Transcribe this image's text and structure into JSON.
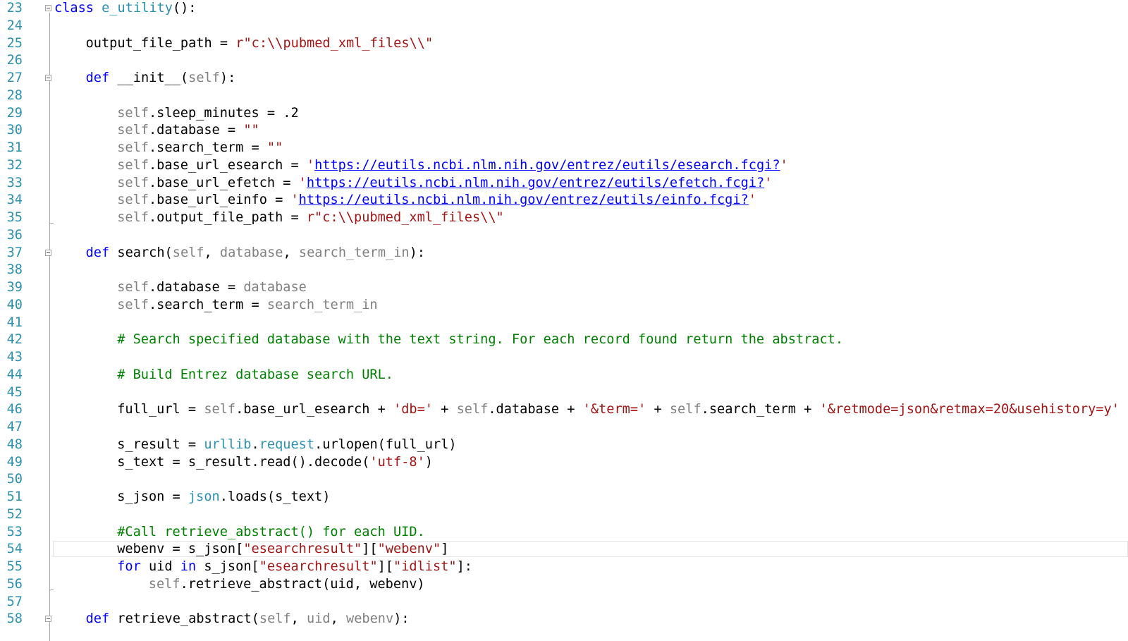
{
  "editor": {
    "first_line": 23,
    "colors": {
      "keyword": "#0000ff",
      "string": "#a31515",
      "comment": "#008000",
      "self_param": "#808080",
      "module": "#2b91af",
      "line_number": "#2b91af"
    },
    "fold_markers": [
      23,
      27,
      37,
      58
    ],
    "lines": [
      {
        "n": "23",
        "indent": 0,
        "tokens": [
          {
            "t": "class ",
            "c": "kw"
          },
          {
            "t": "e_utility",
            "c": "mod"
          },
          {
            "t": "():"
          }
        ]
      },
      {
        "n": "24",
        "indent": 0,
        "tokens": []
      },
      {
        "n": "25",
        "indent": 1,
        "tokens": [
          {
            "t": "output_file_path = "
          },
          {
            "t": "r\"c:\\\\pubmed_xml_files\\\\\"",
            "c": "str"
          }
        ]
      },
      {
        "n": "26",
        "indent": 0,
        "tokens": []
      },
      {
        "n": "27",
        "indent": 1,
        "tokens": [
          {
            "t": "def ",
            "c": "kw"
          },
          {
            "t": "__init__("
          },
          {
            "t": "self",
            "c": "prm"
          },
          {
            "t": "):"
          }
        ]
      },
      {
        "n": "28",
        "indent": 0,
        "tokens": []
      },
      {
        "n": "29",
        "indent": 2,
        "tokens": [
          {
            "t": "self",
            "c": "prm"
          },
          {
            "t": ".sleep_minutes = .2"
          }
        ]
      },
      {
        "n": "30",
        "indent": 2,
        "tokens": [
          {
            "t": "self",
            "c": "prm"
          },
          {
            "t": ".database = "
          },
          {
            "t": "\"\"",
            "c": "str"
          }
        ]
      },
      {
        "n": "31",
        "indent": 2,
        "tokens": [
          {
            "t": "self",
            "c": "prm"
          },
          {
            "t": ".search_term = "
          },
          {
            "t": "\"\"",
            "c": "str"
          }
        ]
      },
      {
        "n": "32",
        "indent": 2,
        "tokens": [
          {
            "t": "self",
            "c": "prm"
          },
          {
            "t": ".base_url_esearch = "
          },
          {
            "t": "'",
            "c": "str"
          },
          {
            "t": "https://eutils.ncbi.nlm.nih.gov/entrez/eutils/esearch.fcgi?",
            "c": "lnk"
          },
          {
            "t": "'",
            "c": "str"
          }
        ]
      },
      {
        "n": "33",
        "indent": 2,
        "tokens": [
          {
            "t": "self",
            "c": "prm"
          },
          {
            "t": ".base_url_efetch = "
          },
          {
            "t": "'",
            "c": "str"
          },
          {
            "t": "https://eutils.ncbi.nlm.nih.gov/entrez/eutils/efetch.fcgi?",
            "c": "lnk"
          },
          {
            "t": "'",
            "c": "str"
          }
        ]
      },
      {
        "n": "34",
        "indent": 2,
        "tokens": [
          {
            "t": "self",
            "c": "prm"
          },
          {
            "t": ".base_url_einfo = "
          },
          {
            "t": "'",
            "c": "str"
          },
          {
            "t": "https://eutils.ncbi.nlm.nih.gov/entrez/eutils/einfo.fcgi?",
            "c": "lnk"
          },
          {
            "t": "'",
            "c": "str"
          }
        ]
      },
      {
        "n": "35",
        "indent": 2,
        "tokens": [
          {
            "t": "self",
            "c": "prm"
          },
          {
            "t": ".output_file_path = "
          },
          {
            "t": "r\"c:\\\\pubmed_xml_files\\\\\"",
            "c": "str"
          }
        ]
      },
      {
        "n": "36",
        "indent": 0,
        "tokens": []
      },
      {
        "n": "37",
        "indent": 1,
        "tokens": [
          {
            "t": "def ",
            "c": "kw"
          },
          {
            "t": "search("
          },
          {
            "t": "self",
            "c": "prm"
          },
          {
            "t": ", "
          },
          {
            "t": "database",
            "c": "prm"
          },
          {
            "t": ", "
          },
          {
            "t": "search_term_in",
            "c": "prm"
          },
          {
            "t": "):"
          }
        ]
      },
      {
        "n": "38",
        "indent": 0,
        "tokens": []
      },
      {
        "n": "39",
        "indent": 2,
        "tokens": [
          {
            "t": "self",
            "c": "prm"
          },
          {
            "t": ".database = "
          },
          {
            "t": "database",
            "c": "prm"
          }
        ]
      },
      {
        "n": "40",
        "indent": 2,
        "tokens": [
          {
            "t": "self",
            "c": "prm"
          },
          {
            "t": ".search_term = "
          },
          {
            "t": "search_term_in",
            "c": "prm"
          }
        ]
      },
      {
        "n": "41",
        "indent": 0,
        "tokens": []
      },
      {
        "n": "42",
        "indent": 2,
        "tokens": [
          {
            "t": "# Search specified database with the text string. For each record found return the abstract.",
            "c": "cmt"
          }
        ]
      },
      {
        "n": "43",
        "indent": 0,
        "tokens": []
      },
      {
        "n": "44",
        "indent": 2,
        "tokens": [
          {
            "t": "# Build Entrez database search URL.",
            "c": "cmt"
          }
        ]
      },
      {
        "n": "45",
        "indent": 0,
        "tokens": []
      },
      {
        "n": "46",
        "indent": 2,
        "tokens": [
          {
            "t": "full_url = "
          },
          {
            "t": "self",
            "c": "prm"
          },
          {
            "t": ".base_url_esearch + "
          },
          {
            "t": "'db='",
            "c": "str"
          },
          {
            "t": " + "
          },
          {
            "t": "self",
            "c": "prm"
          },
          {
            "t": ".database + "
          },
          {
            "t": "'&term='",
            "c": "str"
          },
          {
            "t": " + "
          },
          {
            "t": "self",
            "c": "prm"
          },
          {
            "t": ".search_term + "
          },
          {
            "t": "'&retmode=json&retmax=20&usehistory=y'",
            "c": "str"
          }
        ]
      },
      {
        "n": "47",
        "indent": 0,
        "tokens": []
      },
      {
        "n": "48",
        "indent": 2,
        "tokens": [
          {
            "t": "s_result = "
          },
          {
            "t": "urllib",
            "c": "mod"
          },
          {
            "t": "."
          },
          {
            "t": "request",
            "c": "mod"
          },
          {
            "t": ".urlopen(full_url)"
          }
        ]
      },
      {
        "n": "49",
        "indent": 2,
        "tokens": [
          {
            "t": "s_text = s_result.read().decode("
          },
          {
            "t": "'utf-8'",
            "c": "str"
          },
          {
            "t": ")"
          }
        ]
      },
      {
        "n": "50",
        "indent": 0,
        "tokens": []
      },
      {
        "n": "51",
        "indent": 2,
        "tokens": [
          {
            "t": "s_json = "
          },
          {
            "t": "json",
            "c": "mod"
          },
          {
            "t": ".loads(s_text)"
          }
        ]
      },
      {
        "n": "52",
        "indent": 0,
        "tokens": []
      },
      {
        "n": "53",
        "indent": 2,
        "tokens": [
          {
            "t": "#Call retrieve_abstract() for each UID.",
            "c": "cmt"
          }
        ]
      },
      {
        "n": "54",
        "indent": 2,
        "tokens": [
          {
            "t": "webenv = s_json["
          },
          {
            "t": "\"esearchresult\"",
            "c": "str"
          },
          {
            "t": "]["
          },
          {
            "t": "\"webenv\"",
            "c": "str"
          },
          {
            "t": "]"
          }
        ]
      },
      {
        "n": "55",
        "indent": 2,
        "tokens": [
          {
            "t": "for ",
            "c": "kw"
          },
          {
            "t": "uid "
          },
          {
            "t": "in ",
            "c": "kw"
          },
          {
            "t": "s_json["
          },
          {
            "t": "\"esearchresult\"",
            "c": "str"
          },
          {
            "t": "]["
          },
          {
            "t": "\"idlist\"",
            "c": "str"
          },
          {
            "t": "]:"
          }
        ]
      },
      {
        "n": "56",
        "indent": 3,
        "tokens": [
          {
            "t": "self",
            "c": "prm"
          },
          {
            "t": ".retrieve_abstract(uid, webenv)"
          }
        ]
      },
      {
        "n": "57",
        "indent": 0,
        "tokens": []
      },
      {
        "n": "58",
        "indent": 1,
        "tokens": [
          {
            "t": "def ",
            "c": "kw"
          },
          {
            "t": "retrieve_abstract("
          },
          {
            "t": "self",
            "c": "prm"
          },
          {
            "t": ", "
          },
          {
            "t": "uid",
            "c": "prm"
          },
          {
            "t": ", "
          },
          {
            "t": "webenv",
            "c": "prm"
          },
          {
            "t": "):"
          }
        ]
      }
    ]
  }
}
